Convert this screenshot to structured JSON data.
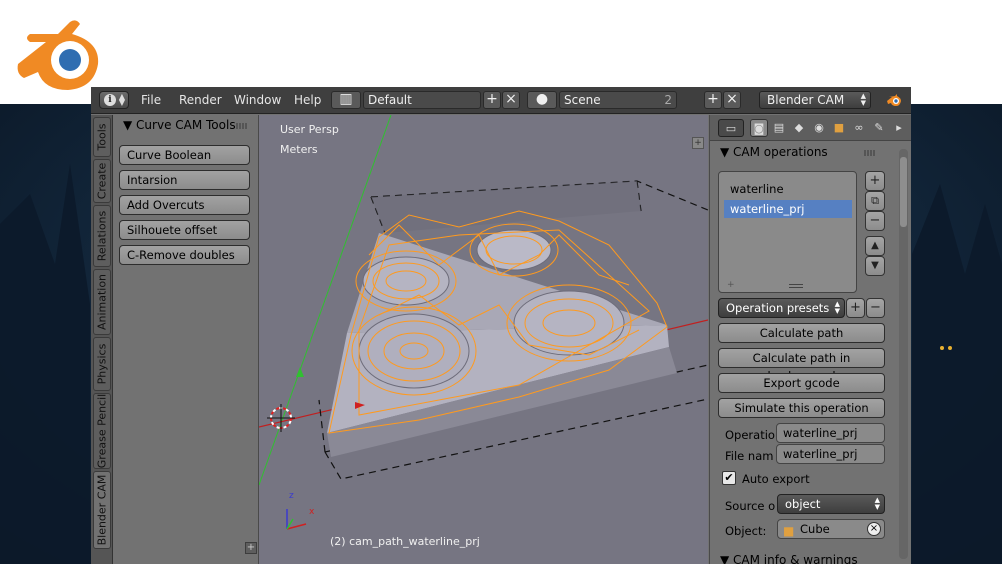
{
  "header": {
    "menus": [
      "File",
      "Render",
      "Window",
      "Help"
    ],
    "screen_layout": "Default",
    "scene_name": "Scene",
    "scene_users": "2",
    "render_engine": "Blender CAM"
  },
  "left_tabs": [
    "Tools",
    "Create",
    "Relations",
    "Animation",
    "Physics",
    "Grease Pencil",
    "Blender CAM"
  ],
  "tool_shelf": {
    "panel_title": "Curve CAM Tools",
    "buttons": [
      "Curve Boolean",
      "Intarsion",
      "Add Overcuts",
      "Silhouete offset",
      "C-Remove doubles"
    ]
  },
  "viewport": {
    "view_name": "User Persp",
    "units": "Meters",
    "object_info": "(2) cam_path_waterline_prj",
    "axis_x": "x",
    "axis_z": "z"
  },
  "properties": {
    "ops_panel_title": "CAM operations",
    "operations": [
      "waterline",
      "waterline_prj"
    ],
    "selected_operation": "waterline_prj",
    "presets_label": "Operation presets",
    "buttons": {
      "calculate": "Calculate path",
      "calculate_bg": "Calculate path in background",
      "export": "Export gcode",
      "simulate": "Simulate this operation"
    },
    "operation_name_label": "Operatio",
    "operation_name_value": "waterline_prj",
    "file_name_label": "File nam",
    "file_name_value": "waterline_prj",
    "auto_export_label": "Auto export",
    "source_label": "Source o",
    "source_value": "object",
    "object_label": "Object:",
    "object_value": "Cube",
    "info_panel_title": "CAM info & warnings"
  },
  "colors": {
    "selection": "#5680c2",
    "toolpath": "#ff9a1e",
    "x_axis": "#d02020",
    "y_axis": "#30c030"
  }
}
